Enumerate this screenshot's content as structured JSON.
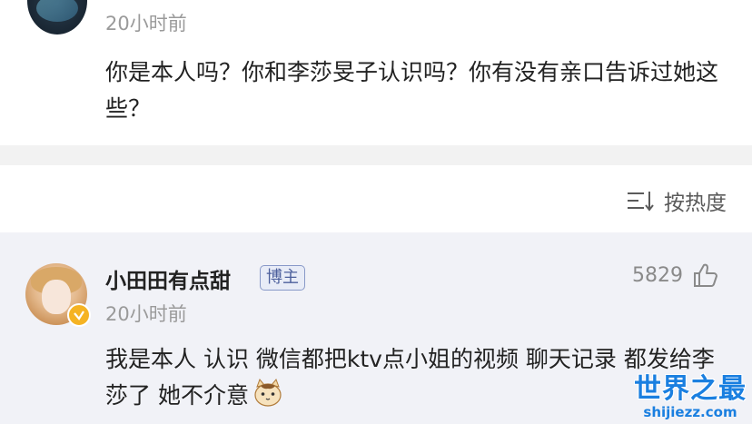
{
  "top_comment": {
    "time": "20小时前",
    "text": "你是本人吗？你和李莎旻子认识吗？你有没有亲口告诉过她这些？"
  },
  "sort": {
    "label": "按热度",
    "icon": "sort-icon"
  },
  "main_comment": {
    "username": "小田田有点甜",
    "badge": "博主",
    "likes": "5829",
    "time": "20小时前",
    "text": "我是本人 认识 微信都把ktv点小姐的视频 聊天记录 都发给李莎了 她不介意",
    "emoji": "cat-emoji"
  },
  "watermark": {
    "main": "世界之最",
    "sub": "shijiezz.com"
  },
  "colors": {
    "accent": "#1a7fe0",
    "verified": "#f5b323",
    "badge_border": "#8899c8",
    "main_bg": "#f1f2f7"
  }
}
